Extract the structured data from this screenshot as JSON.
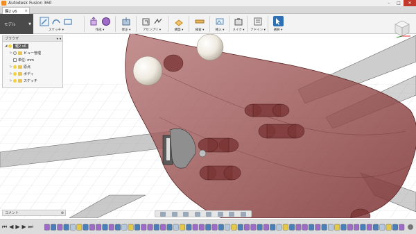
{
  "window": {
    "title": "Autodesk Fusion 360",
    "minimize": "–",
    "maximize": "□",
    "close": "✕"
  },
  "doc_tab": {
    "label": "鍵2 v6",
    "close": "×"
  },
  "toolbar": {
    "workspace": "モデル",
    "workspace_arrow": "▼",
    "groups": [
      {
        "label": "スケッチ ▾"
      },
      {
        "label": "作成 ▾"
      },
      {
        "label": "修正 ▾"
      },
      {
        "label": "アセンブリ ▾"
      },
      {
        "label": "構築 ▾"
      },
      {
        "label": "検査 ▾"
      },
      {
        "label": "挿入 ▾"
      },
      {
        "label": "メイク ▾"
      },
      {
        "label": "アドイン ▾"
      },
      {
        "label": "選択 ▾"
      }
    ]
  },
  "browser": {
    "header": "ブラウザ",
    "header_ctrl": "◂ ◂",
    "root": {
      "label": "鍵2 v6"
    },
    "items": [
      {
        "label": "ビュー管理"
      },
      {
        "label": "単位: mm"
      },
      {
        "label": "原点"
      },
      {
        "label": "ボディ"
      },
      {
        "label": "スケッチ"
      }
    ]
  },
  "comments": {
    "label": "コメント",
    "ctrl": "⊕"
  },
  "timeline": {
    "controls": [
      "⏮",
      "◀",
      "▶",
      "▶",
      "⏭"
    ]
  },
  "colors": {
    "toolbar_bg": "#f3f3f3",
    "workspace_bg": "#4a4a4a",
    "body_fill": "#8f3b3b",
    "wing_fill": "#9a9a9a",
    "select_accent": "#2f6fb4"
  }
}
